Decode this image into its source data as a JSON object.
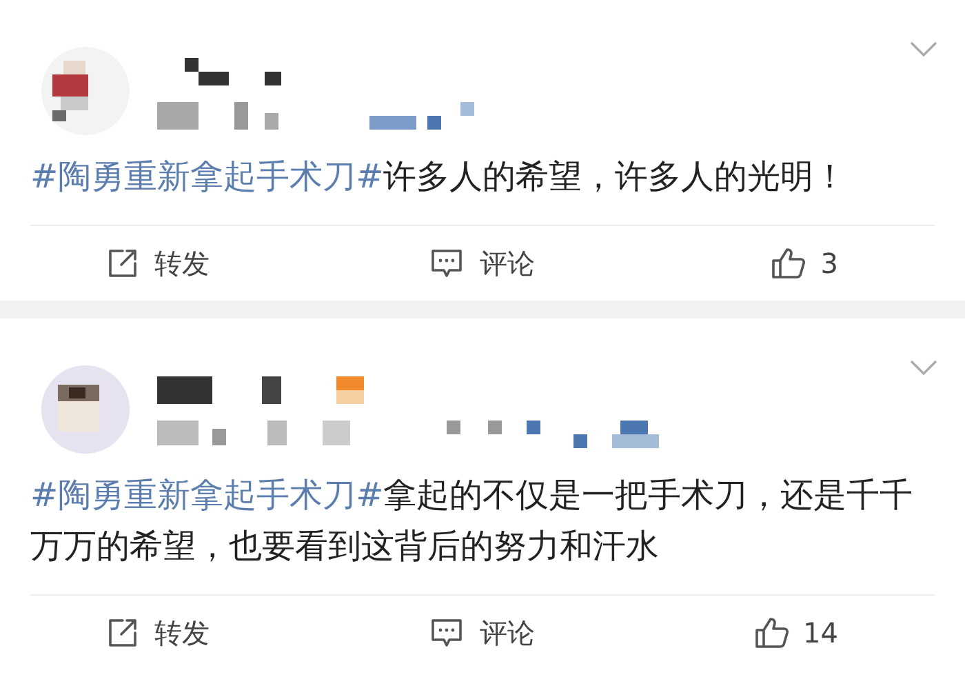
{
  "posts": [
    {
      "hashtag": "#陶勇重新拿起手术刀#",
      "text": "许多人的希望，许多人的光明！",
      "actions": {
        "repost": "转发",
        "comment": "评论",
        "likes": "3"
      }
    },
    {
      "hashtag": "#陶勇重新拿起手术刀#",
      "text": "拿起的不仅是一把手术刀，还是千千万万的希望，也要看到这背后的努力和汗水",
      "actions": {
        "repost": "转发",
        "comment": "评论",
        "likes": "14"
      }
    }
  ]
}
